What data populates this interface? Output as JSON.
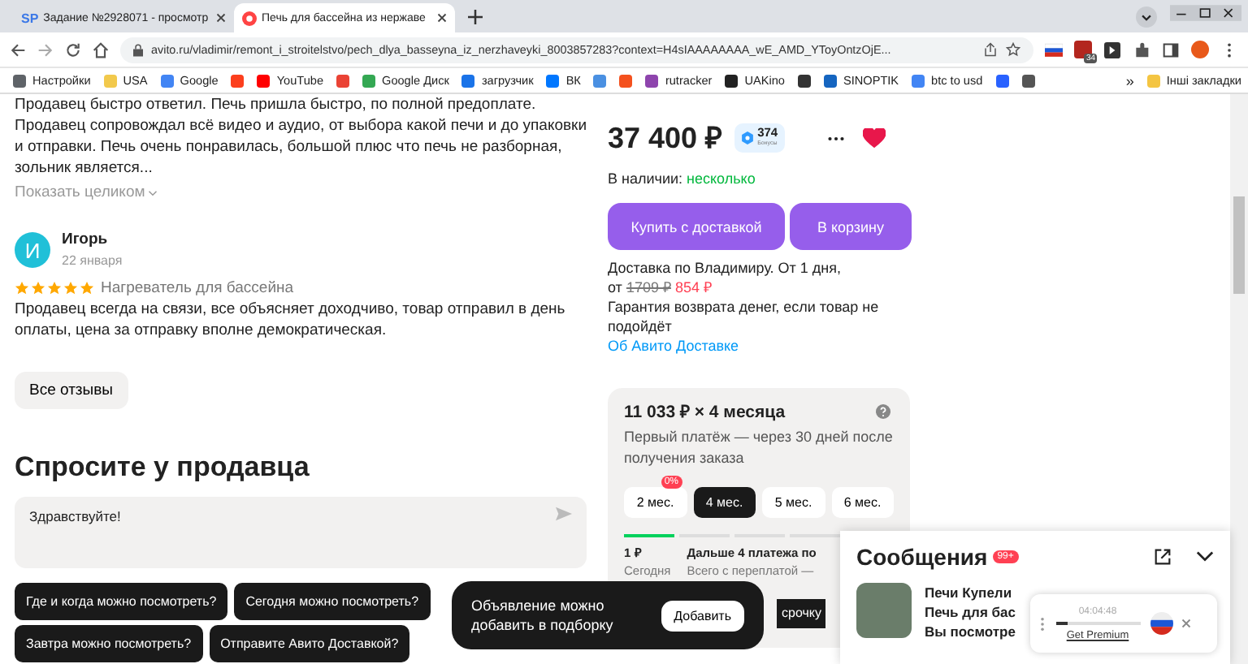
{
  "browser": {
    "tabs": [
      {
        "logo": "SP",
        "title": "Задание №2928071 - просмотр",
        "selected": false
      },
      {
        "title": "Печь для бассейна из нержаве",
        "selected": true
      }
    ],
    "address": "avito.ru/vladimir/remont_i_stroitelstvo/pech_dlya_basseyna_iz_nerzhaveyki_8003857283?context=H4sIAAAAAAAA_wE_AMD_YToyOntzOjE...",
    "extension_badge": "34",
    "bookmarks": [
      {
        "label": "Настройки",
        "color": "#5f6368"
      },
      {
        "label": "USA",
        "color": "#f2c94c"
      },
      {
        "label": "Google",
        "color": "#4285f4"
      },
      {
        "color": "#fc3f1d"
      },
      {
        "label": "YouTube",
        "color": "#ff0000"
      },
      {
        "color": "#ea4335"
      },
      {
        "label": "Google Диск",
        "color": "#34a853"
      },
      {
        "label": "загрузчик",
        "color": "#1a73e8"
      },
      {
        "label": "ВК",
        "color": "#0077ff"
      },
      {
        "color": "#4a90e2"
      },
      {
        "color": "#f4511e"
      },
      {
        "label": "rutracker",
        "color": "#8e44ad"
      },
      {
        "label": "UAKino",
        "color": "#222222"
      },
      {
        "color": "#333333"
      },
      {
        "label": "SINOPTIK",
        "color": "#1565c0"
      },
      {
        "label": "btc to usd",
        "color": "#4285f4"
      },
      {
        "color": "#2962ff"
      },
      {
        "color": "#555555"
      }
    ],
    "more_bookmarks": "»",
    "other_bookmarks": "Інші закладки"
  },
  "review_1": {
    "text": "Продавец быстро ответил. Печь пришла быстро, по полной предоплате. Продавец сопровождал всё видео и аудио, от выбора какой печи и до упаковки и отправки. Печь очень понравилась, большой плюс что печь не разборная, зольник является...",
    "more": "Показать целиком"
  },
  "review_2": {
    "initial": "И",
    "name": "Игорь",
    "date": "22 января",
    "stars": 5,
    "product": "Нагреватель для бассейна",
    "text": "Продавец всегда на связи, все объясняет доходчиво, товар отправил в день оплаты, цена за отправку вполне демократическая."
  },
  "all_reviews": "Все отзывы",
  "ask": {
    "title": "Спросите у продавца",
    "value": "Здравствуйте!",
    "suggestions": [
      "Где и когда можно посмотреть?",
      "Сегодня можно посмотреть?",
      "Завтра можно посмотреть?",
      "Отправите Авито Доставкой?"
    ]
  },
  "price": {
    "amount": "37 400 ₽",
    "bonus": "374",
    "bonus_label": "Бонусы",
    "favorite": true
  },
  "stock": {
    "label": "В наличии:",
    "value": "несколько"
  },
  "actions": [
    "Купить с доставкой",
    "В корзину"
  ],
  "delivery": {
    "line": "Доставка по Владимиру. От 1 дня,",
    "from": "от",
    "old_price": "1709 ₽",
    "new_price": "854 ₽",
    "guarantee": "Гарантия возврата денег, если товар не подойдёт",
    "link": "Об Авито Доставке"
  },
  "installment": {
    "title": "11 033 ₽ × 4 месяца",
    "subtitle": "Первый платёж — через 30 дней после получения заказа",
    "options": [
      {
        "label": "2 мес.",
        "selected": false,
        "badge": "0%"
      },
      {
        "label": "4 мес.",
        "selected": true
      },
      {
        "label": "5 мес.",
        "selected": false
      },
      {
        "label": "6 мес.",
        "selected": false
      }
    ],
    "segments": [
      {
        "done": true
      },
      {
        "done": false
      },
      {
        "done": false
      },
      {
        "done": false
      }
    ],
    "first_amount": "1 ₽",
    "first_when": "Сегодня",
    "next": "Дальше 4 платежа по",
    "total": "Всего с переплатой —",
    "button": "срочку"
  },
  "toast": {
    "text": "Объявление можно добавить в подборку",
    "button": "Добавить"
  },
  "messages": {
    "title": "Сообщения",
    "badge": "99+",
    "chat": {
      "name": "Печи Купели",
      "subject": "Печь для бас",
      "preview": "Вы посмотре"
    }
  },
  "vpn": {
    "timer": "04:04:48",
    "level": 0.15,
    "link": "Get Premium"
  }
}
